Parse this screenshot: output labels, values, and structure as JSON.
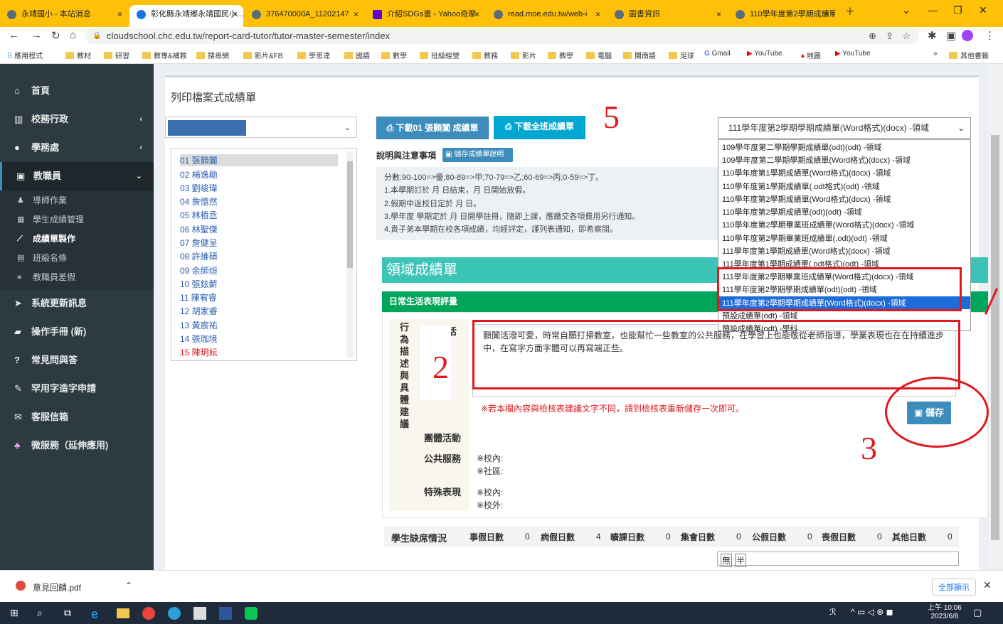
{
  "tabs": [
    {
      "label": "永靖國小 - 本站消息"
    },
    {
      "label": "彰化縣永靖鄉永靖國民小..."
    },
    {
      "label": "376470000A_11202147"
    },
    {
      "label": "介紹SDGs書 - Yahoo奇摩"
    },
    {
      "label": "read.moe.edu.tw/web-i"
    },
    {
      "label": "圖書資訊"
    },
    {
      "label": "110學年度第2學期成績單"
    }
  ],
  "address": {
    "url": "cloudschool.chc.edu.tw/report-card-tutor/tutor-master-semester/index"
  },
  "bookmarks": [
    "應用程式",
    "教材",
    "研習",
    "教專&補救",
    "搜尋網",
    "影片&FB",
    "學思達",
    "國語",
    "數學",
    "班級經營",
    "教務",
    "影片",
    "教學",
    "電腦",
    "閩南語",
    "足球",
    "Gmail",
    "YouTube",
    "地圖",
    "YouTube",
    "其他書籤"
  ],
  "sidebar": {
    "items": [
      {
        "label": "首頁",
        "icon": "home-icon"
      },
      {
        "label": "校務行政",
        "icon": "bank-icon"
      },
      {
        "label": "學務處",
        "icon": "info-icon"
      },
      {
        "label": "教職員",
        "icon": "id-card-icon"
      }
    ],
    "subitems": [
      {
        "label": "導師作業"
      },
      {
        "label": "學生成績管理"
      },
      {
        "label": "成績單製作"
      },
      {
        "label": "班級名條"
      },
      {
        "label": "教職員差假"
      }
    ],
    "bottom": [
      {
        "label": "系統更新訊息"
      },
      {
        "label": "操作手冊 (新)"
      },
      {
        "label": "常見問與答"
      },
      {
        "label": "罕用字造字申請"
      },
      {
        "label": "客服信箱"
      },
      {
        "label": "微服務（延伸應用)"
      }
    ]
  },
  "page": {
    "title": "列印檔案式成績單",
    "download_one": "下載01 張顥闐 成績單",
    "download_all": "下載全班成績單",
    "notes_title": "說明與注意事項",
    "notes_button": "儲存成績單說明",
    "notes": [
      "分數:90-100=>優;80-89=>甲;70-79=>乙;60-69=>丙;0-59=>丁。",
      "1.本學期訂於 月 日結束，月 日開始放假。",
      "2.假期中返校日定於 月 日。",
      "3.學年度 學期定於 月 日開學註冊，隨即上課，應繳交各項費用另行通知。",
      "4.貴子弟本學期在校各項成績，均經評定，謹列表通知，即希察閱。"
    ],
    "format_selected": "111學年度第2學期學期成績單(Word格式)(docx) -領域",
    "format_options": [
      "109學年度第二學期學期成績單(odt)(odt) -領域",
      "109學年度第二學期學期成績單(Word格式)(docx) -領域",
      "110學年度第1學期成績單(Word格式)(docx) -領域",
      "110學年度第1學期成績單(.odt格式)(odt) -領域",
      "110學年度第2學期成績單(Word格式)(docx) -領域",
      "110學年度第2學期成績單(odt)(odt) -領域",
      "110學年度第2學期畢業班成績單(Word格式)(docx) -領域",
      "110學年度第2學期畢業班成績單(.odt)(odt) -領域",
      "111學年度第1學期成績單(Word格式)(docx) -領域",
      "111學年度第1學期成績單(.odt格式)(odt) -領域",
      "111學年度第2學期畢業班成績單(Word格式)(docx) -領域",
      "111學年度第2學期學期成績單(odt)(odt) -領域",
      "111學年度第2學期學期成績單(Word格式)(docx) -領域",
      "預設成績單(odt) -領域",
      "預設成績單(odt) -學科"
    ],
    "students": [
      "01 張顥闐",
      "02 楊逸勛",
      "03 劉峻瑋",
      "04 詹憶然",
      "05 林栢丞",
      "06 林聖傑",
      "07 詹健呈",
      "08 許維碩",
      "09 余師烜",
      "10 張鉉薪",
      "11 陳宥睿",
      "12 胡家睿",
      "13 黃宸祐",
      "14 張珈境",
      "15 陳玥妘"
    ],
    "section_title": "領域成績單",
    "daily_title": "日常生活表現評量",
    "behavior_label": "行為描述與具體建議",
    "daily_life": "日常生活",
    "comment": "顥闐活潑可愛，時常自願打掃教室，也能幫忙一些教室的公共服務，在學習上也能敬從老師指導，學業表現也在在持續進步中，在寫字方面字體可以再寫端正些。",
    "warning": "※若本欄內容與檢核表建議文字不同，請到檢核表重新儲存一次即可。",
    "save_button": "儲存",
    "group_activity": "團體活動",
    "public_service": "公共服務",
    "public_service_val": [
      "※校內:",
      "※社區:"
    ],
    "special": "特殊表現",
    "special_val": [
      "※校內:",
      "※校外:"
    ],
    "attendance": {
      "label": "學生缺席情況",
      "items": [
        {
          "name": "事假日數",
          "value": "0"
        },
        {
          "name": "病假日數",
          "value": "4"
        },
        {
          "name": "曠課日數",
          "value": "0"
        },
        {
          "name": "集會日數",
          "value": "0"
        },
        {
          "name": "公假日數",
          "value": "0"
        },
        {
          "name": "喪假日數",
          "value": "0"
        },
        {
          "name": "其他日數",
          "value": "0"
        }
      ]
    },
    "ime": [
      "無",
      "半"
    ],
    "annotations": [
      "5",
      "2",
      "3"
    ]
  },
  "downloads": {
    "file": "意見回饋.pdf",
    "show_all": "全部顯示"
  },
  "taskbar": {
    "time": "上午 10:06",
    "date": "2023/6/8"
  }
}
